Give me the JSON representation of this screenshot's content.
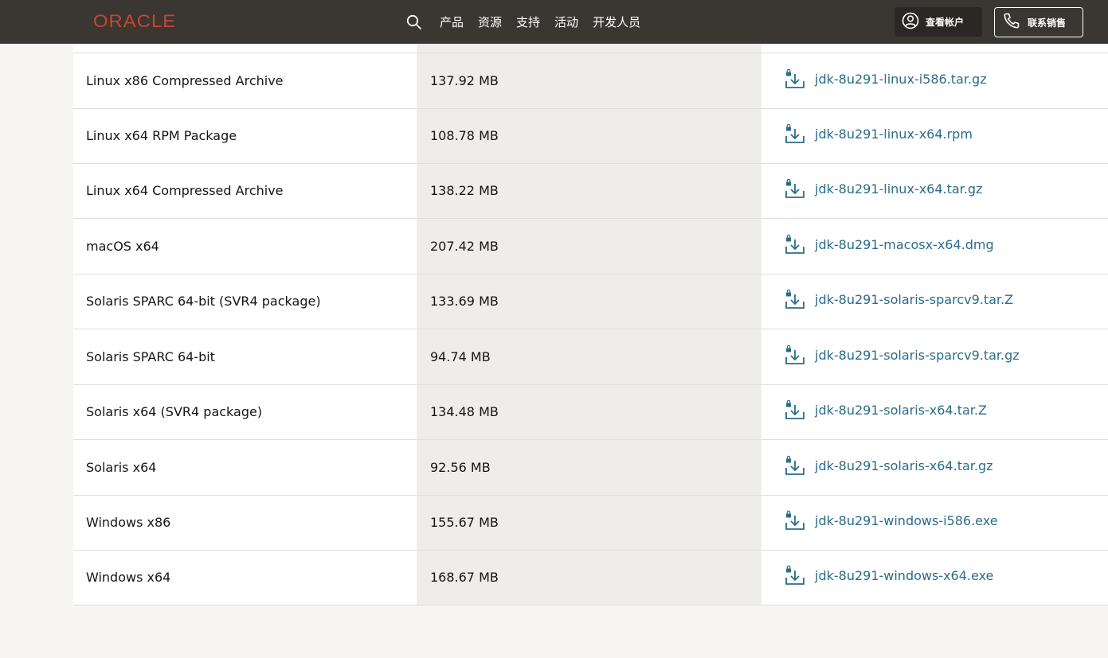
{
  "header": {
    "logo_text": "ORACLE",
    "nav": [
      "产品",
      "资源",
      "支持",
      "活动",
      "开发人员"
    ],
    "account_label": "查看帐户",
    "sales_label": "联系销售",
    "brand_color": "#c74634"
  },
  "downloads": [
    {
      "name": "Linux x86 Compressed Archive",
      "size": "137.92 MB",
      "file": "jdk-8u291-linux-i586.tar.gz"
    },
    {
      "name": "Linux x64 RPM Package",
      "size": "108.78 MB",
      "file": "jdk-8u291-linux-x64.rpm"
    },
    {
      "name": "Linux x64 Compressed Archive",
      "size": "138.22 MB",
      "file": "jdk-8u291-linux-x64.tar.gz"
    },
    {
      "name": "macOS x64",
      "size": "207.42 MB",
      "file": "jdk-8u291-macosx-x64.dmg"
    },
    {
      "name": "Solaris SPARC 64-bit (SVR4 package)",
      "size": "133.69 MB",
      "file": "jdk-8u291-solaris-sparcv9.tar.Z"
    },
    {
      "name": "Solaris SPARC 64-bit",
      "size": "94.74 MB",
      "file": "jdk-8u291-solaris-sparcv9.tar.gz"
    },
    {
      "name": "Solaris x64 (SVR4 package)",
      "size": "134.48 MB",
      "file": "jdk-8u291-solaris-x64.tar.Z"
    },
    {
      "name": "Solaris x64",
      "size": "92.56 MB",
      "file": "jdk-8u291-solaris-x64.tar.gz"
    },
    {
      "name": "Windows x86",
      "size": "155.67 MB",
      "file": "jdk-8u291-windows-i586.exe"
    },
    {
      "name": "Windows x64",
      "size": "168.67 MB",
      "file": "jdk-8u291-windows-x64.exe"
    }
  ],
  "icons": {
    "search": "search-icon",
    "account": "user-circle-icon",
    "phone": "phone-icon",
    "download": "lock-download-icon"
  },
  "colors": {
    "link": "#2b6c8a",
    "header_bg": "#3a3632"
  }
}
